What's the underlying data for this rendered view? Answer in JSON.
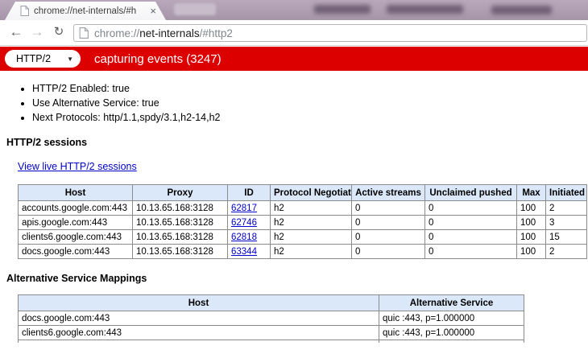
{
  "colors": {
    "accent_red": "#dd0000",
    "table_header_blue": "#dbe8f9",
    "link_blue": "#0000cc",
    "frame_purple": "#ab9aad"
  },
  "icons": {
    "back": "←",
    "forward": "→",
    "reload": "↻",
    "dropdown_arrow": "▼",
    "close": "×"
  },
  "browser": {
    "tab_title": "chrome://net-internals/#h",
    "url_scheme": "chrome://",
    "url_host": "net-internals",
    "url_path": "/#http2"
  },
  "capture_bar": {
    "dropdown_value": "HTTP/2",
    "status_text": "capturing events (3247)"
  },
  "http2": {
    "bullets": [
      "HTTP/2 Enabled: true",
      "Use Alternative Service: true",
      "Next Protocols: http/1.1,spdy/3.1,h2-14,h2"
    ],
    "sessions_heading": "HTTP/2 sessions",
    "sessions_link": "View live HTTP/2 sessions",
    "sessions_table": {
      "headers": [
        "Host",
        "Proxy",
        "ID",
        "Protocol Negotiated",
        "Active streams",
        "Unclaimed pushed",
        "Max",
        "Initiated"
      ],
      "rows": [
        {
          "host": "accounts.google.com:443",
          "proxy": "10.13.65.168:3128",
          "id": "62817",
          "protocol": "h2",
          "active": "0",
          "unclaimed": "0",
          "max": "100",
          "initiated": "2"
        },
        {
          "host": "apis.google.com:443",
          "proxy": "10.13.65.168:3128",
          "id": "62746",
          "protocol": "h2",
          "active": "0",
          "unclaimed": "0",
          "max": "100",
          "initiated": "3"
        },
        {
          "host": "clients6.google.com:443",
          "proxy": "10.13.65.168:3128",
          "id": "62818",
          "protocol": "h2",
          "active": "0",
          "unclaimed": "0",
          "max": "100",
          "initiated": "15"
        },
        {
          "host": "docs.google.com:443",
          "proxy": "10.13.65.168:3128",
          "id": "63344",
          "protocol": "h2",
          "active": "0",
          "unclaimed": "0",
          "max": "100",
          "initiated": "2"
        }
      ]
    },
    "alt_heading": "Alternative Service Mappings",
    "alt_table": {
      "headers": [
        "Host",
        "Alternative Service"
      ],
      "rows": [
        {
          "host": "docs.google.com:443",
          "service": "quic :443, p=1.000000"
        },
        {
          "host": "clients6.google.com:443",
          "service": "quic :443, p=1.000000"
        }
      ]
    }
  }
}
